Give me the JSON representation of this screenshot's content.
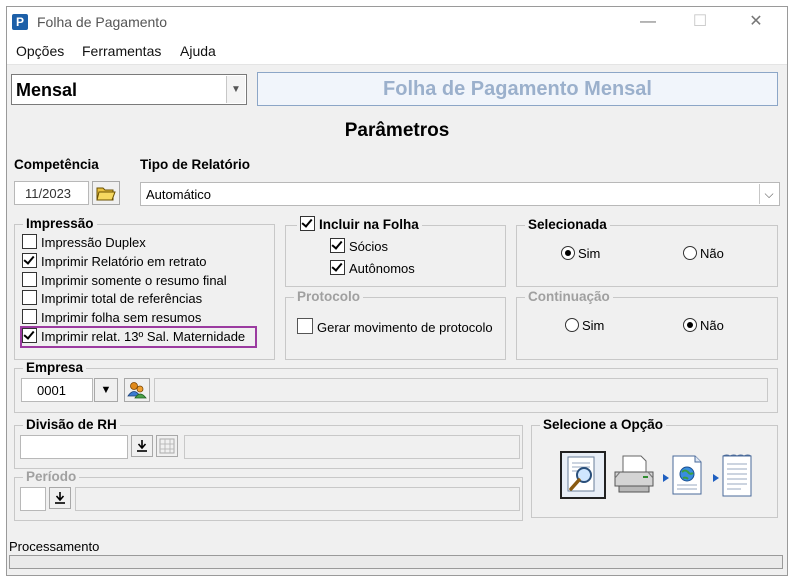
{
  "window": {
    "title": "Folha de Pagamento",
    "app_icon_letter": "P",
    "minimize": "—",
    "maximize": "☐",
    "close": "✕"
  },
  "menu": [
    "Opções",
    "Ferramentas",
    "Ajuda"
  ],
  "top": {
    "frequency_value": "Mensal",
    "heading": "Folha de Pagamento Mensal"
  },
  "section_title": "Parâmetros",
  "competencia": {
    "label": "Competência",
    "value": "11/2023"
  },
  "tipo_relatorio": {
    "label": "Tipo de Relatório",
    "value": "Automático"
  },
  "impressao": {
    "title": "Impressão",
    "items": [
      {
        "label": "Impressão Duplex",
        "checked": false
      },
      {
        "label": "Imprimir Relatório em retrato",
        "checked": true
      },
      {
        "label": "Imprimir somente o resumo final",
        "checked": false
      },
      {
        "label": "Imprimir total de referências",
        "checked": false
      },
      {
        "label": "Imprimir folha sem resumos",
        "checked": false
      },
      {
        "label": "Imprimir relat. 13º Sal. Maternidade",
        "checked": true
      }
    ]
  },
  "incluir": {
    "title": "Incluir na Folha",
    "checked": true,
    "items": [
      {
        "label": "Sócios",
        "checked": true
      },
      {
        "label": "Autônomos",
        "checked": true
      }
    ]
  },
  "selecionada": {
    "title": "Selecionada",
    "options": [
      {
        "label": "Sim",
        "selected": true
      },
      {
        "label": "Não",
        "selected": false
      }
    ]
  },
  "protocolo": {
    "title": "Protocolo",
    "item": {
      "label": "Gerar movimento de protocolo",
      "checked": false
    }
  },
  "continuacao": {
    "title": "Continuação",
    "options": [
      {
        "label": "Sim",
        "selected": false
      },
      {
        "label": "Não",
        "selected": true
      }
    ]
  },
  "empresa": {
    "title": "Empresa",
    "code": "0001",
    "name": ""
  },
  "divisao": {
    "title": "Divisão de RH",
    "code": "",
    "name": ""
  },
  "periodo": {
    "title": "Período",
    "code": "",
    "name": ""
  },
  "selecione": {
    "title": "Selecione a Opção",
    "buttons": [
      "preview-icon",
      "printer-icon",
      "export-globe-icon",
      "export-document-icon"
    ]
  },
  "status": {
    "label": "Processamento"
  }
}
